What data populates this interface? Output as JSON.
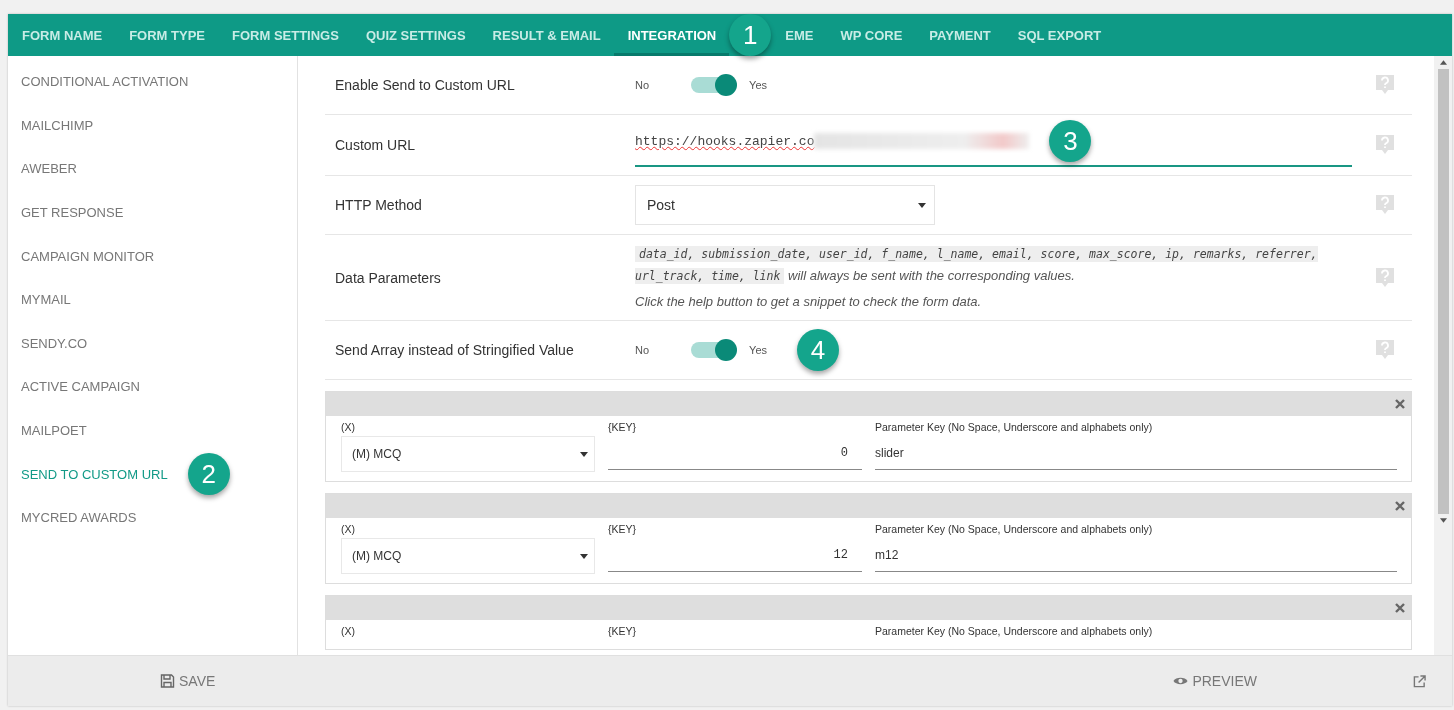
{
  "tabs": [
    {
      "label": "FORM NAME",
      "selected": false
    },
    {
      "label": "FORM TYPE",
      "selected": false
    },
    {
      "label": "FORM SETTINGS",
      "selected": false
    },
    {
      "label": "QUIZ SETTINGS",
      "selected": false
    },
    {
      "label": "RESULT & EMAIL",
      "selected": false
    },
    {
      "label": "INTEGRATION",
      "selected": true,
      "callout": "1"
    },
    {
      "label": "EME",
      "selected": false
    },
    {
      "label": "WP CORE",
      "selected": false
    },
    {
      "label": "PAYMENT",
      "selected": false
    },
    {
      "label": "SQL EXPORT",
      "selected": false
    }
  ],
  "sidebar": {
    "items": [
      {
        "label": "CONDITIONAL ACTIVATION",
        "selected": false
      },
      {
        "label": "MAILCHIMP",
        "selected": false
      },
      {
        "label": "AWEBER",
        "selected": false
      },
      {
        "label": "GET RESPONSE",
        "selected": false
      },
      {
        "label": "CAMPAIGN MONITOR",
        "selected": false
      },
      {
        "label": "MYMAIL",
        "selected": false
      },
      {
        "label": "SENDY.CO",
        "selected": false
      },
      {
        "label": "ACTIVE CAMPAIGN",
        "selected": false
      },
      {
        "label": "MAILPOET",
        "selected": false
      },
      {
        "label": "SEND TO CUSTOM URL",
        "selected": true,
        "callout": "2"
      },
      {
        "label": "MYCRED AWARDS",
        "selected": false
      }
    ]
  },
  "settings": [
    {
      "kind": "toggle",
      "label": "Enable Send to Custom URL",
      "off_label": "No",
      "on_label": "Yes",
      "on": true
    },
    {
      "kind": "text",
      "label": "Custom URL",
      "value": "https://hooks.zapier.co",
      "redacted": true,
      "callout": "3"
    },
    {
      "kind": "select",
      "label": "HTTP Method",
      "value": "Post"
    },
    {
      "kind": "info",
      "label": "Data Parameters",
      "code": "data_id, submission_date, user_id, f_name, l_name, email, score, max_score, ip, remarks, referrer, url_track, time, link",
      "text": "will always be sent with the corresponding values.",
      "note": "Click the help button to get a snippet to check the form data."
    },
    {
      "kind": "toggle",
      "label": "Send Array instead of Stringified Value",
      "off_label": "No",
      "on_label": "Yes",
      "on": true,
      "callout": "4"
    }
  ],
  "param_blocks": [
    {
      "x_label": "(X)",
      "key_label": "{KEY}",
      "param_label": "Parameter Key (No Space, Underscore and alphabets only)",
      "x_value": "(M) MCQ",
      "key_value": "0",
      "param_value": "slider"
    },
    {
      "x_label": "(X)",
      "key_label": "{KEY}",
      "param_label": "Parameter Key (No Space, Underscore and alphabets only)",
      "x_value": "(M) MCQ",
      "key_value": "12",
      "param_value": "m12"
    },
    {
      "x_label": "(X)",
      "key_label": "{KEY}",
      "param_label": "Parameter Key (No Space, Underscore and alphabets only)"
    }
  ],
  "footer": {
    "save": "SAVE",
    "preview": "PREVIEW"
  }
}
